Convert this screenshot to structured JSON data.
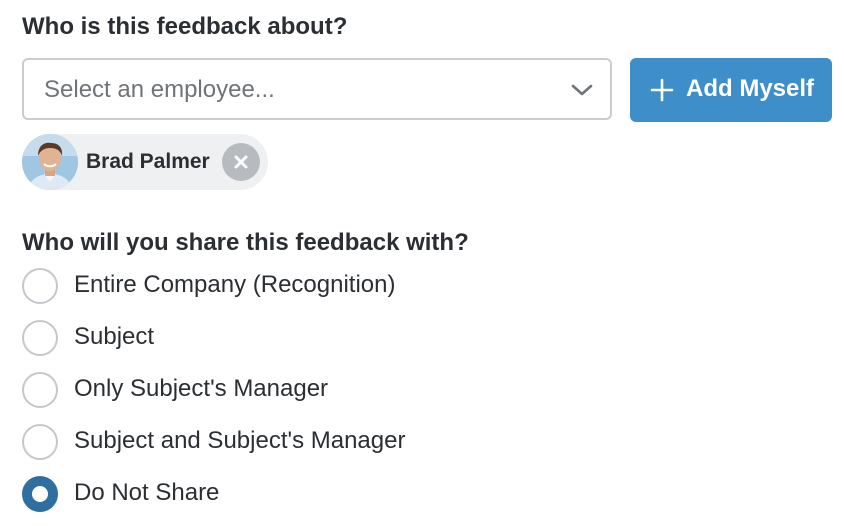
{
  "section_about": {
    "title": "Who is this feedback about?",
    "select_placeholder": "Select an employee...",
    "add_myself_label": "Add Myself",
    "selected_employee": {
      "name": "Brad Palmer"
    }
  },
  "section_share": {
    "title": "Who will you share this feedback with?",
    "options": [
      {
        "label": "Entire Company (Recognition)",
        "checked": false
      },
      {
        "label": "Subject",
        "checked": false
      },
      {
        "label": "Only Subject's Manager",
        "checked": false
      },
      {
        "label": "Subject and Subject's Manager",
        "checked": false
      },
      {
        "label": "Do Not Share",
        "checked": true
      }
    ]
  },
  "colors": {
    "primary_button": "#3d8ec9",
    "radio_checked": "#2f6f9f",
    "chip_background": "#eef0f2"
  },
  "icons": {
    "dropdown": "chevron-down-icon",
    "add": "plus-icon",
    "remove": "close-icon"
  }
}
